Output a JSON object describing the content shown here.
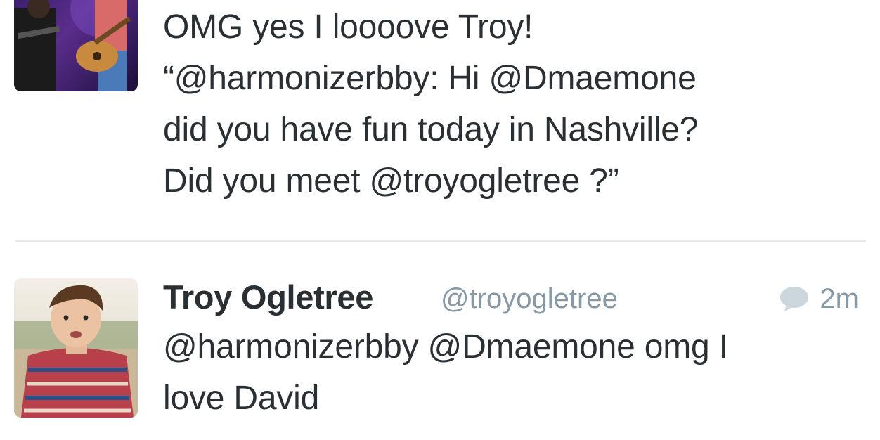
{
  "timeline": {
    "tweets": [
      {
        "avatar_alt": "concert-photo-avatar",
        "text_lines": [
          "OMG yes I loooove Troy!",
          "“@harmonizerbby: Hi @Dmaemone",
          "did you have fun today in Nashville?",
          "Did you meet @troyogletree ?”"
        ]
      },
      {
        "author_name": "Troy Ogletree",
        "author_handle": "@troyogletree",
        "timestamp": "2m",
        "reply_icon": "speech-bubble-icon",
        "text_lines": [
          "@harmonizerbby @Dmaemone omg I",
          "love David"
        ]
      }
    ]
  },
  "colors": {
    "text": "#292f33",
    "muted": "#8899a6",
    "divider": "#e6e9ec"
  }
}
